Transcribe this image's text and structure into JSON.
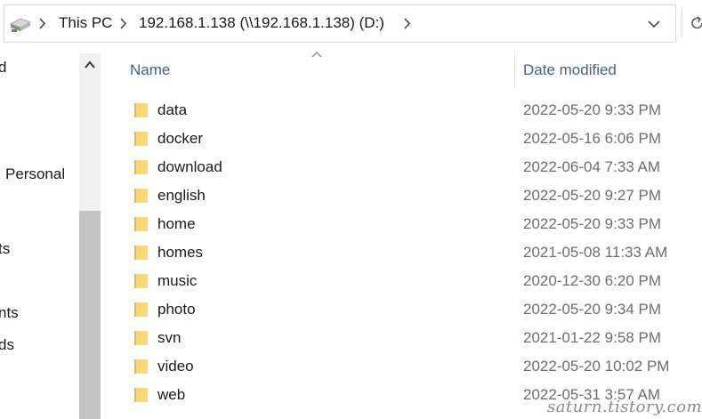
{
  "address": {
    "crumbs": [
      "This PC",
      "192.168.1.138 (\\\\192.168.1.138) (D:)"
    ],
    "drive_icon": "network-drive-icon"
  },
  "nav": {
    "items": [
      "d",
      "Personal",
      "ts",
      "nts",
      "ds"
    ]
  },
  "list": {
    "columns": {
      "name": "Name",
      "date_modified": "Date modified"
    },
    "sort": "Name ascending",
    "rows": [
      {
        "name": "data",
        "date": "2022-05-20 9:33 PM"
      },
      {
        "name": "docker",
        "date": "2022-05-16 6:06 PM"
      },
      {
        "name": "download",
        "date": "2022-06-04 7:33 AM"
      },
      {
        "name": "english",
        "date": "2022-05-20 9:27 PM"
      },
      {
        "name": "home",
        "date": "2022-05-20 9:33 PM"
      },
      {
        "name": "homes",
        "date": "2021-05-08 11:33 AM"
      },
      {
        "name": "music",
        "date": "2020-12-30 6:20 PM"
      },
      {
        "name": "photo",
        "date": "2022-05-20 9:34 PM"
      },
      {
        "name": "svn",
        "date": "2021-01-22 9:58 PM"
      },
      {
        "name": "video",
        "date": "2022-05-20 10:02 PM"
      },
      {
        "name": "web",
        "date": "2022-05-31 3:57 AM"
      }
    ]
  },
  "watermark": "saturn.tistory.com",
  "colors": {
    "folder": "#f8d775",
    "header_text": "#4c607a",
    "date_text": "#6d6d6d"
  }
}
